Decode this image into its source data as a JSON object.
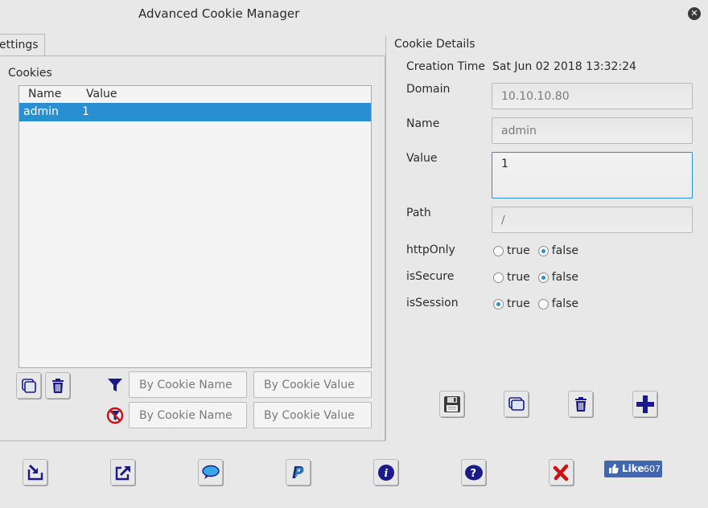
{
  "window": {
    "title": "Advanced Cookie Manager"
  },
  "tabs": [
    {
      "label": "ettings"
    }
  ],
  "cookies": {
    "section_label": "Cookies",
    "columns": [
      "Name",
      "Value"
    ],
    "rows": [
      {
        "name": "admin",
        "value": "1",
        "selected": true
      }
    ],
    "filter": {
      "name_placeholder": "By Cookie Name",
      "value_placeholder": "By Cookie Value",
      "exclude_name_placeholder": "By Cookie Name",
      "exclude_value_placeholder": "By Cookie Value"
    }
  },
  "details": {
    "section_label": "Cookie Details",
    "creation_time_label": "Creation Time",
    "creation_time_value": "Sat Jun 02 2018 13:32:24",
    "domain_label": "Domain",
    "domain_value": "10.10.10.80",
    "name_label": "Name",
    "name_value": "admin",
    "value_label": "Value",
    "value_value": "1",
    "path_label": "Path",
    "path_value": "/",
    "httponly_label": "httpOnly",
    "issecure_label": "isSecure",
    "issession_label": "isSession",
    "true_label": "true",
    "false_label": "false",
    "httponly": false,
    "issecure": false,
    "issession": true
  },
  "like": {
    "label": "Like",
    "count": "607"
  },
  "colors": {
    "accent": "#2a8ed3",
    "icon_blue": "#1a1a8c",
    "delete_red": "#cc1111",
    "facebook": "#4267b2"
  }
}
